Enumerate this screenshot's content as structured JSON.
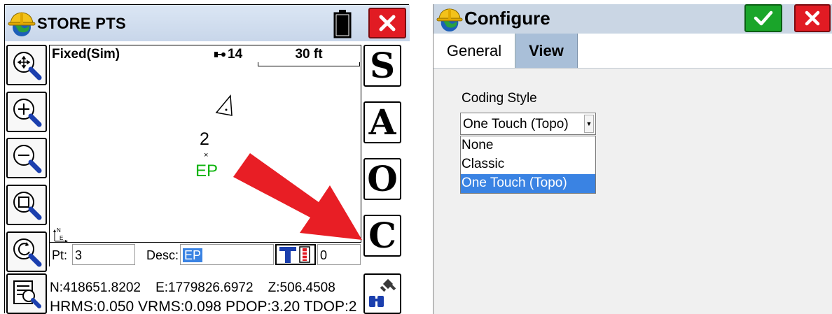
{
  "left_window": {
    "title": "STORE PTS",
    "gps_status": "Fixed(Sim)",
    "satellites": "14",
    "scale": "30 ft",
    "map": {
      "point_number": "2",
      "point_marker": "×",
      "point_description": "EP",
      "north_arrow": {
        "north": "N",
        "east": "E"
      }
    },
    "right_buttons": [
      {
        "name": "s-button",
        "label": "S"
      },
      {
        "name": "a-button",
        "label": "A"
      },
      {
        "name": "o-button",
        "label": "O"
      },
      {
        "name": "c-button",
        "label": "C"
      }
    ],
    "left_buttons": [
      {
        "name": "zoom-extents-button",
        "icon": "zoom-extents-icon"
      },
      {
        "name": "zoom-in-button",
        "icon": "zoom-in-icon"
      },
      {
        "name": "zoom-out-button",
        "icon": "zoom-out-icon"
      },
      {
        "name": "zoom-window-button",
        "icon": "zoom-window-icon"
      },
      {
        "name": "zoom-previous-button",
        "icon": "zoom-previous-icon"
      },
      {
        "name": "point-list-button",
        "icon": "list-magnifier-icon"
      }
    ],
    "fields": {
      "pt_label": "Pt:",
      "pt_value": "3",
      "desc_label": "Desc:",
      "desc_value": "EP",
      "height_value": "0"
    },
    "coords": {
      "north": "N:418651.8202",
      "east": "E:1779826.6972",
      "elev": "Z:506.4508"
    },
    "quality": "HRMS:0.050 VRMS:0.098 PDOP:3.20 TDOP:2",
    "accent_red": "#e11b23"
  },
  "right_window": {
    "title": "Configure",
    "tabs": [
      {
        "label": "General",
        "active": false
      },
      {
        "label": "View",
        "active": true
      }
    ],
    "coding_style_label": "Coding Style",
    "coding_style_value": "One Touch (Topo)",
    "coding_style_options": [
      "None",
      "Classic",
      "One Touch (Topo)"
    ],
    "selected_option": "One Touch (Topo)",
    "accent_green": "#1aa52a",
    "selection_blue": "#3a83e3"
  }
}
